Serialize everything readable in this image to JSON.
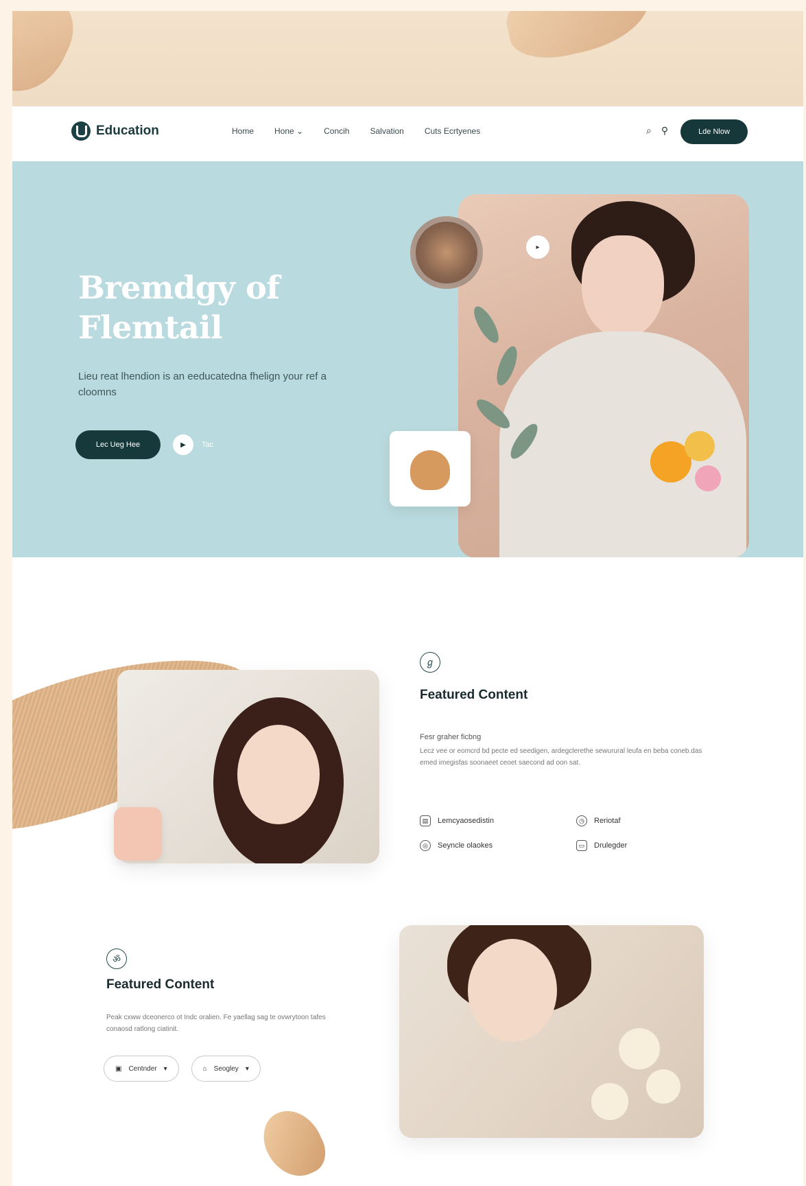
{
  "nav": {
    "logo_text": "Education",
    "links": [
      "Home",
      "Hone",
      "Concih",
      "Salvation",
      "Cuts Ecrtyenes"
    ],
    "links_dropdown_indicator": "⌄",
    "cta": "Lde Nlow",
    "search_icon": "search-icon",
    "user_icon": "user-icon"
  },
  "hero": {
    "title": "Bremdgy of Flemtail",
    "subtitle": "Lieu reat lhendion is an eeducatedna fhelign your ref a cloomns",
    "primary_button": "Lec Ueg Hee",
    "secondary_label": "Tac",
    "play_icon": "play-icon",
    "dot_icon": "arrow-icon"
  },
  "feature1": {
    "icon_glyph": "ℊ",
    "title": "Featured Content",
    "subhead": "Fesr graher ficbng",
    "body": "Lecz vee or eomcrd bd pecte ed seedigen, ardegclerethe sewurural leufa en beba coneb.das emed imegisfas soonaeet ceoet saecond ad oon sat.",
    "items": [
      {
        "label": "Lemcyaosedistin",
        "icon": "document-icon"
      },
      {
        "label": "Reriotaf",
        "icon": "clock-icon"
      },
      {
        "label": "Seyncle olaokes",
        "icon": "badge-icon"
      },
      {
        "label": "Drulegder",
        "icon": "card-icon"
      }
    ]
  },
  "feature2": {
    "icon_glyph": "ॐ",
    "title": "Featured Content",
    "body": "Peak cxww dceonerco ot Indc oralien. Fe yaellag sag te ovwrytoon tafes conaosd ratlong ciatinit.",
    "buttons": [
      {
        "label": "Centnder",
        "icon": "folder-icon"
      },
      {
        "label": "Seogley",
        "icon": "home-icon"
      }
    ],
    "button_caret": "▾"
  },
  "colors": {
    "hero_bg": "#b9dade",
    "brand_dark": "#17383b",
    "page_bg": "#fdf3e6",
    "accent_petal": "#d9ae86"
  }
}
